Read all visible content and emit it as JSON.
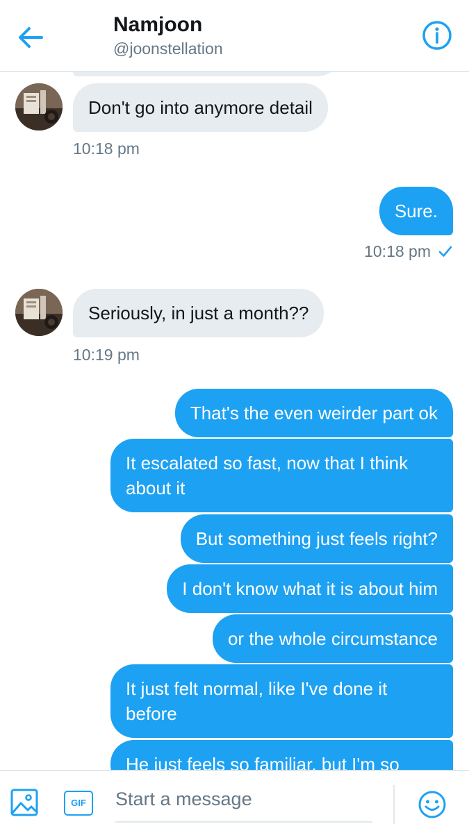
{
  "header": {
    "name": "Namjoon",
    "handle": "@joonstellation",
    "back_icon": "arrow-left-icon",
    "info_icon": "info-circle-icon"
  },
  "messages": [
    {
      "direction": "in",
      "text": "Don't go into anymore detail"
    },
    {
      "direction": "in",
      "timestamp": "10:18 pm"
    },
    {
      "direction": "out",
      "text": "Sure."
    },
    {
      "direction": "out",
      "timestamp": "10:18 pm",
      "status_icon": "checkmark-icon"
    },
    {
      "direction": "in",
      "text": "Seriously, in just a month??"
    },
    {
      "direction": "in",
      "timestamp": "10:19 pm"
    },
    {
      "direction": "out",
      "text": "That's the even weirder part ok"
    },
    {
      "direction": "out",
      "text": "It escalated so fast, now that I think about it"
    },
    {
      "direction": "out",
      "text": "But something just feels right?"
    },
    {
      "direction": "out",
      "text": "I don't know what it is about him"
    },
    {
      "direction": "out",
      "text": "or the whole circumstance"
    },
    {
      "direction": "out",
      "text": "It just felt normal, like I've done it before"
    },
    {
      "direction": "out",
      "text": "He just feels so familiar, but I'm so"
    }
  ],
  "composer": {
    "placeholder": "Start a message",
    "gif_label": "GIF",
    "image_icon": "image-icon",
    "emoji_icon": "emoji-icon"
  },
  "colors": {
    "accent": "#1da1f2",
    "incoming_bubble": "#e6ecf0",
    "secondary_text": "#657786"
  }
}
